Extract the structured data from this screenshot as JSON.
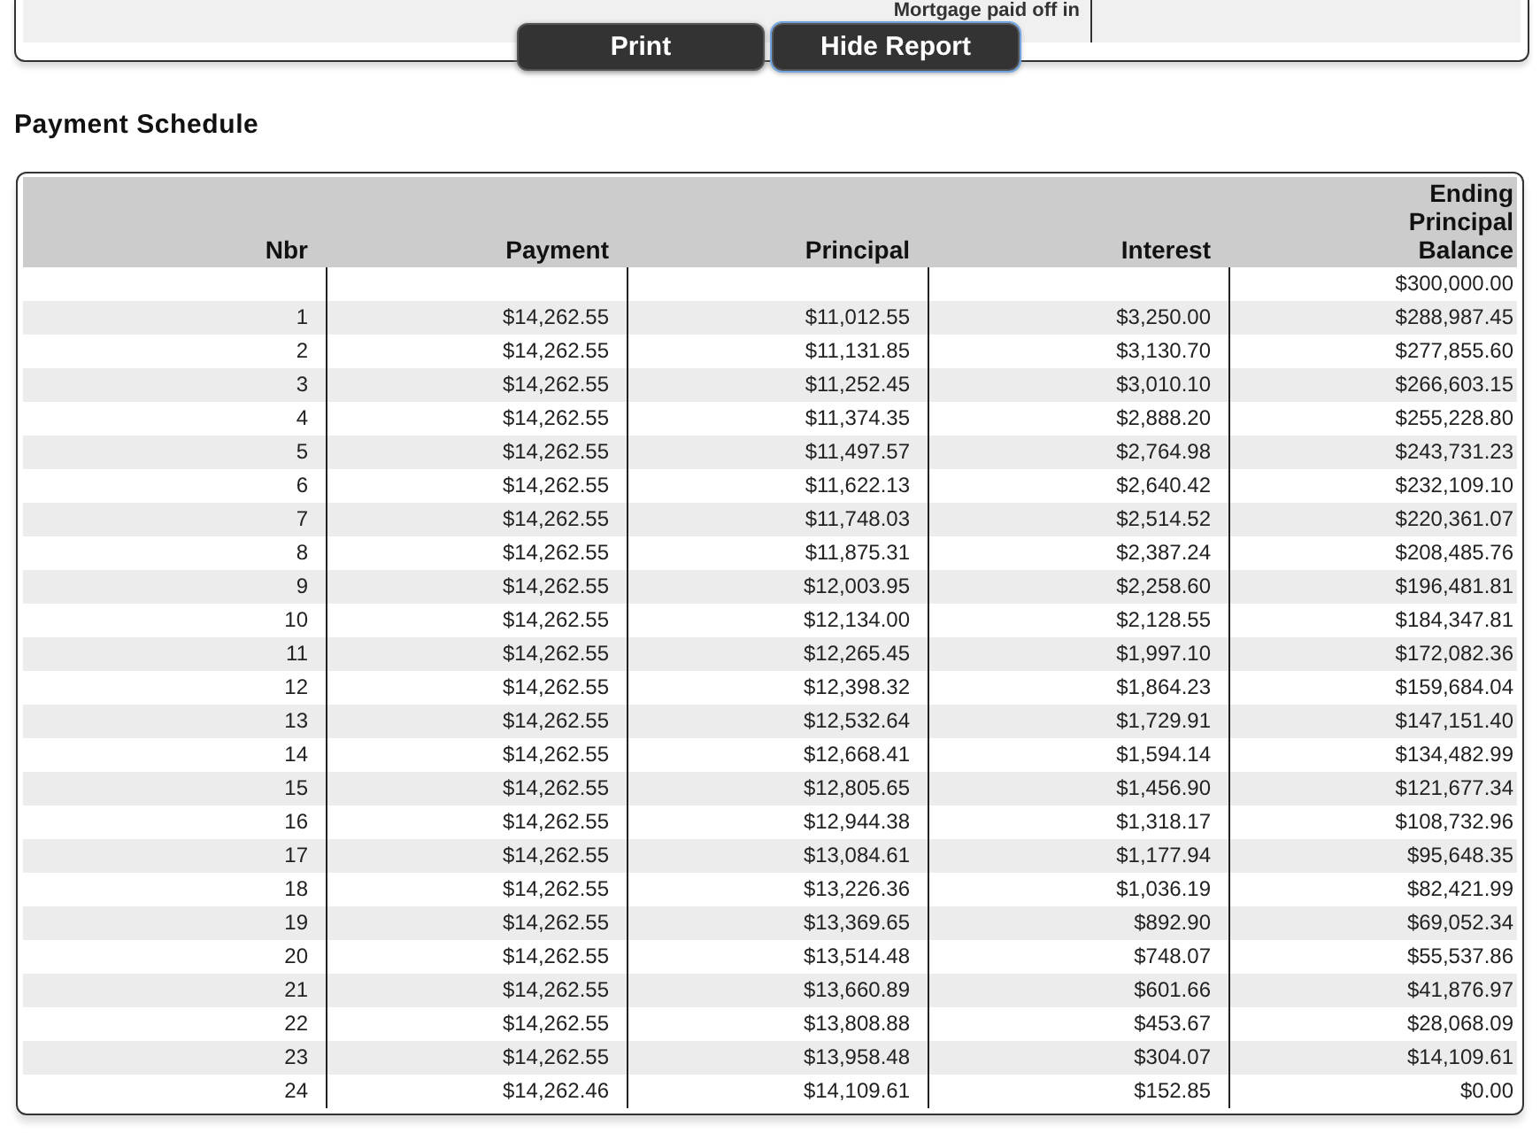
{
  "summary_panel": {
    "label": "Mortgage paid off in"
  },
  "buttons": [
    {
      "label": "Print",
      "focused": false
    },
    {
      "label": "Hide Report",
      "focused": true
    }
  ],
  "section_title": "Payment Schedule",
  "table": {
    "columns": [
      "Nbr",
      "Payment",
      "Principal",
      "Interest",
      "Ending Principal Balance"
    ],
    "rows": [
      {
        "balance": "$300,000.00"
      },
      {
        "nbr": "1",
        "payment": "$14,262.55",
        "principal": "$11,012.55",
        "interest": "$3,250.00",
        "balance": "$288,987.45"
      },
      {
        "nbr": "2",
        "payment": "$14,262.55",
        "principal": "$11,131.85",
        "interest": "$3,130.70",
        "balance": "$277,855.60"
      },
      {
        "nbr": "3",
        "payment": "$14,262.55",
        "principal": "$11,252.45",
        "interest": "$3,010.10",
        "balance": "$266,603.15"
      },
      {
        "nbr": "4",
        "payment": "$14,262.55",
        "principal": "$11,374.35",
        "interest": "$2,888.20",
        "balance": "$255,228.80"
      },
      {
        "nbr": "5",
        "payment": "$14,262.55",
        "principal": "$11,497.57",
        "interest": "$2,764.98",
        "balance": "$243,731.23"
      },
      {
        "nbr": "6",
        "payment": "$14,262.55",
        "principal": "$11,622.13",
        "interest": "$2,640.42",
        "balance": "$232,109.10"
      },
      {
        "nbr": "7",
        "payment": "$14,262.55",
        "principal": "$11,748.03",
        "interest": "$2,514.52",
        "balance": "$220,361.07"
      },
      {
        "nbr": "8",
        "payment": "$14,262.55",
        "principal": "$11,875.31",
        "interest": "$2,387.24",
        "balance": "$208,485.76"
      },
      {
        "nbr": "9",
        "payment": "$14,262.55",
        "principal": "$12,003.95",
        "interest": "$2,258.60",
        "balance": "$196,481.81"
      },
      {
        "nbr": "10",
        "payment": "$14,262.55",
        "principal": "$12,134.00",
        "interest": "$2,128.55",
        "balance": "$184,347.81"
      },
      {
        "nbr": "11",
        "payment": "$14,262.55",
        "principal": "$12,265.45",
        "interest": "$1,997.10",
        "balance": "$172,082.36"
      },
      {
        "nbr": "12",
        "payment": "$14,262.55",
        "principal": "$12,398.32",
        "interest": "$1,864.23",
        "balance": "$159,684.04"
      },
      {
        "nbr": "13",
        "payment": "$14,262.55",
        "principal": "$12,532.64",
        "interest": "$1,729.91",
        "balance": "$147,151.40"
      },
      {
        "nbr": "14",
        "payment": "$14,262.55",
        "principal": "$12,668.41",
        "interest": "$1,594.14",
        "balance": "$134,482.99"
      },
      {
        "nbr": "15",
        "payment": "$14,262.55",
        "principal": "$12,805.65",
        "interest": "$1,456.90",
        "balance": "$121,677.34"
      },
      {
        "nbr": "16",
        "payment": "$14,262.55",
        "principal": "$12,944.38",
        "interest": "$1,318.17",
        "balance": "$108,732.96"
      },
      {
        "nbr": "17",
        "payment": "$14,262.55",
        "principal": "$13,084.61",
        "interest": "$1,177.94",
        "balance": "$95,648.35"
      },
      {
        "nbr": "18",
        "payment": "$14,262.55",
        "principal": "$13,226.36",
        "interest": "$1,036.19",
        "balance": "$82,421.99"
      },
      {
        "nbr": "19",
        "payment": "$14,262.55",
        "principal": "$13,369.65",
        "interest": "$892.90",
        "balance": "$69,052.34"
      },
      {
        "nbr": "20",
        "payment": "$14,262.55",
        "principal": "$13,514.48",
        "interest": "$748.07",
        "balance": "$55,537.86"
      },
      {
        "nbr": "21",
        "payment": "$14,262.55",
        "principal": "$13,660.89",
        "interest": "$601.66",
        "balance": "$41,876.97"
      },
      {
        "nbr": "22",
        "payment": "$14,262.55",
        "principal": "$13,808.88",
        "interest": "$453.67",
        "balance": "$28,068.09"
      },
      {
        "nbr": "23",
        "payment": "$14,262.55",
        "principal": "$13,958.48",
        "interest": "$304.07",
        "balance": "$14,109.61"
      },
      {
        "nbr": "24",
        "payment": "$14,262.46",
        "principal": "$14,109.61",
        "interest": "$152.85",
        "balance": "$0.00"
      }
    ]
  }
}
